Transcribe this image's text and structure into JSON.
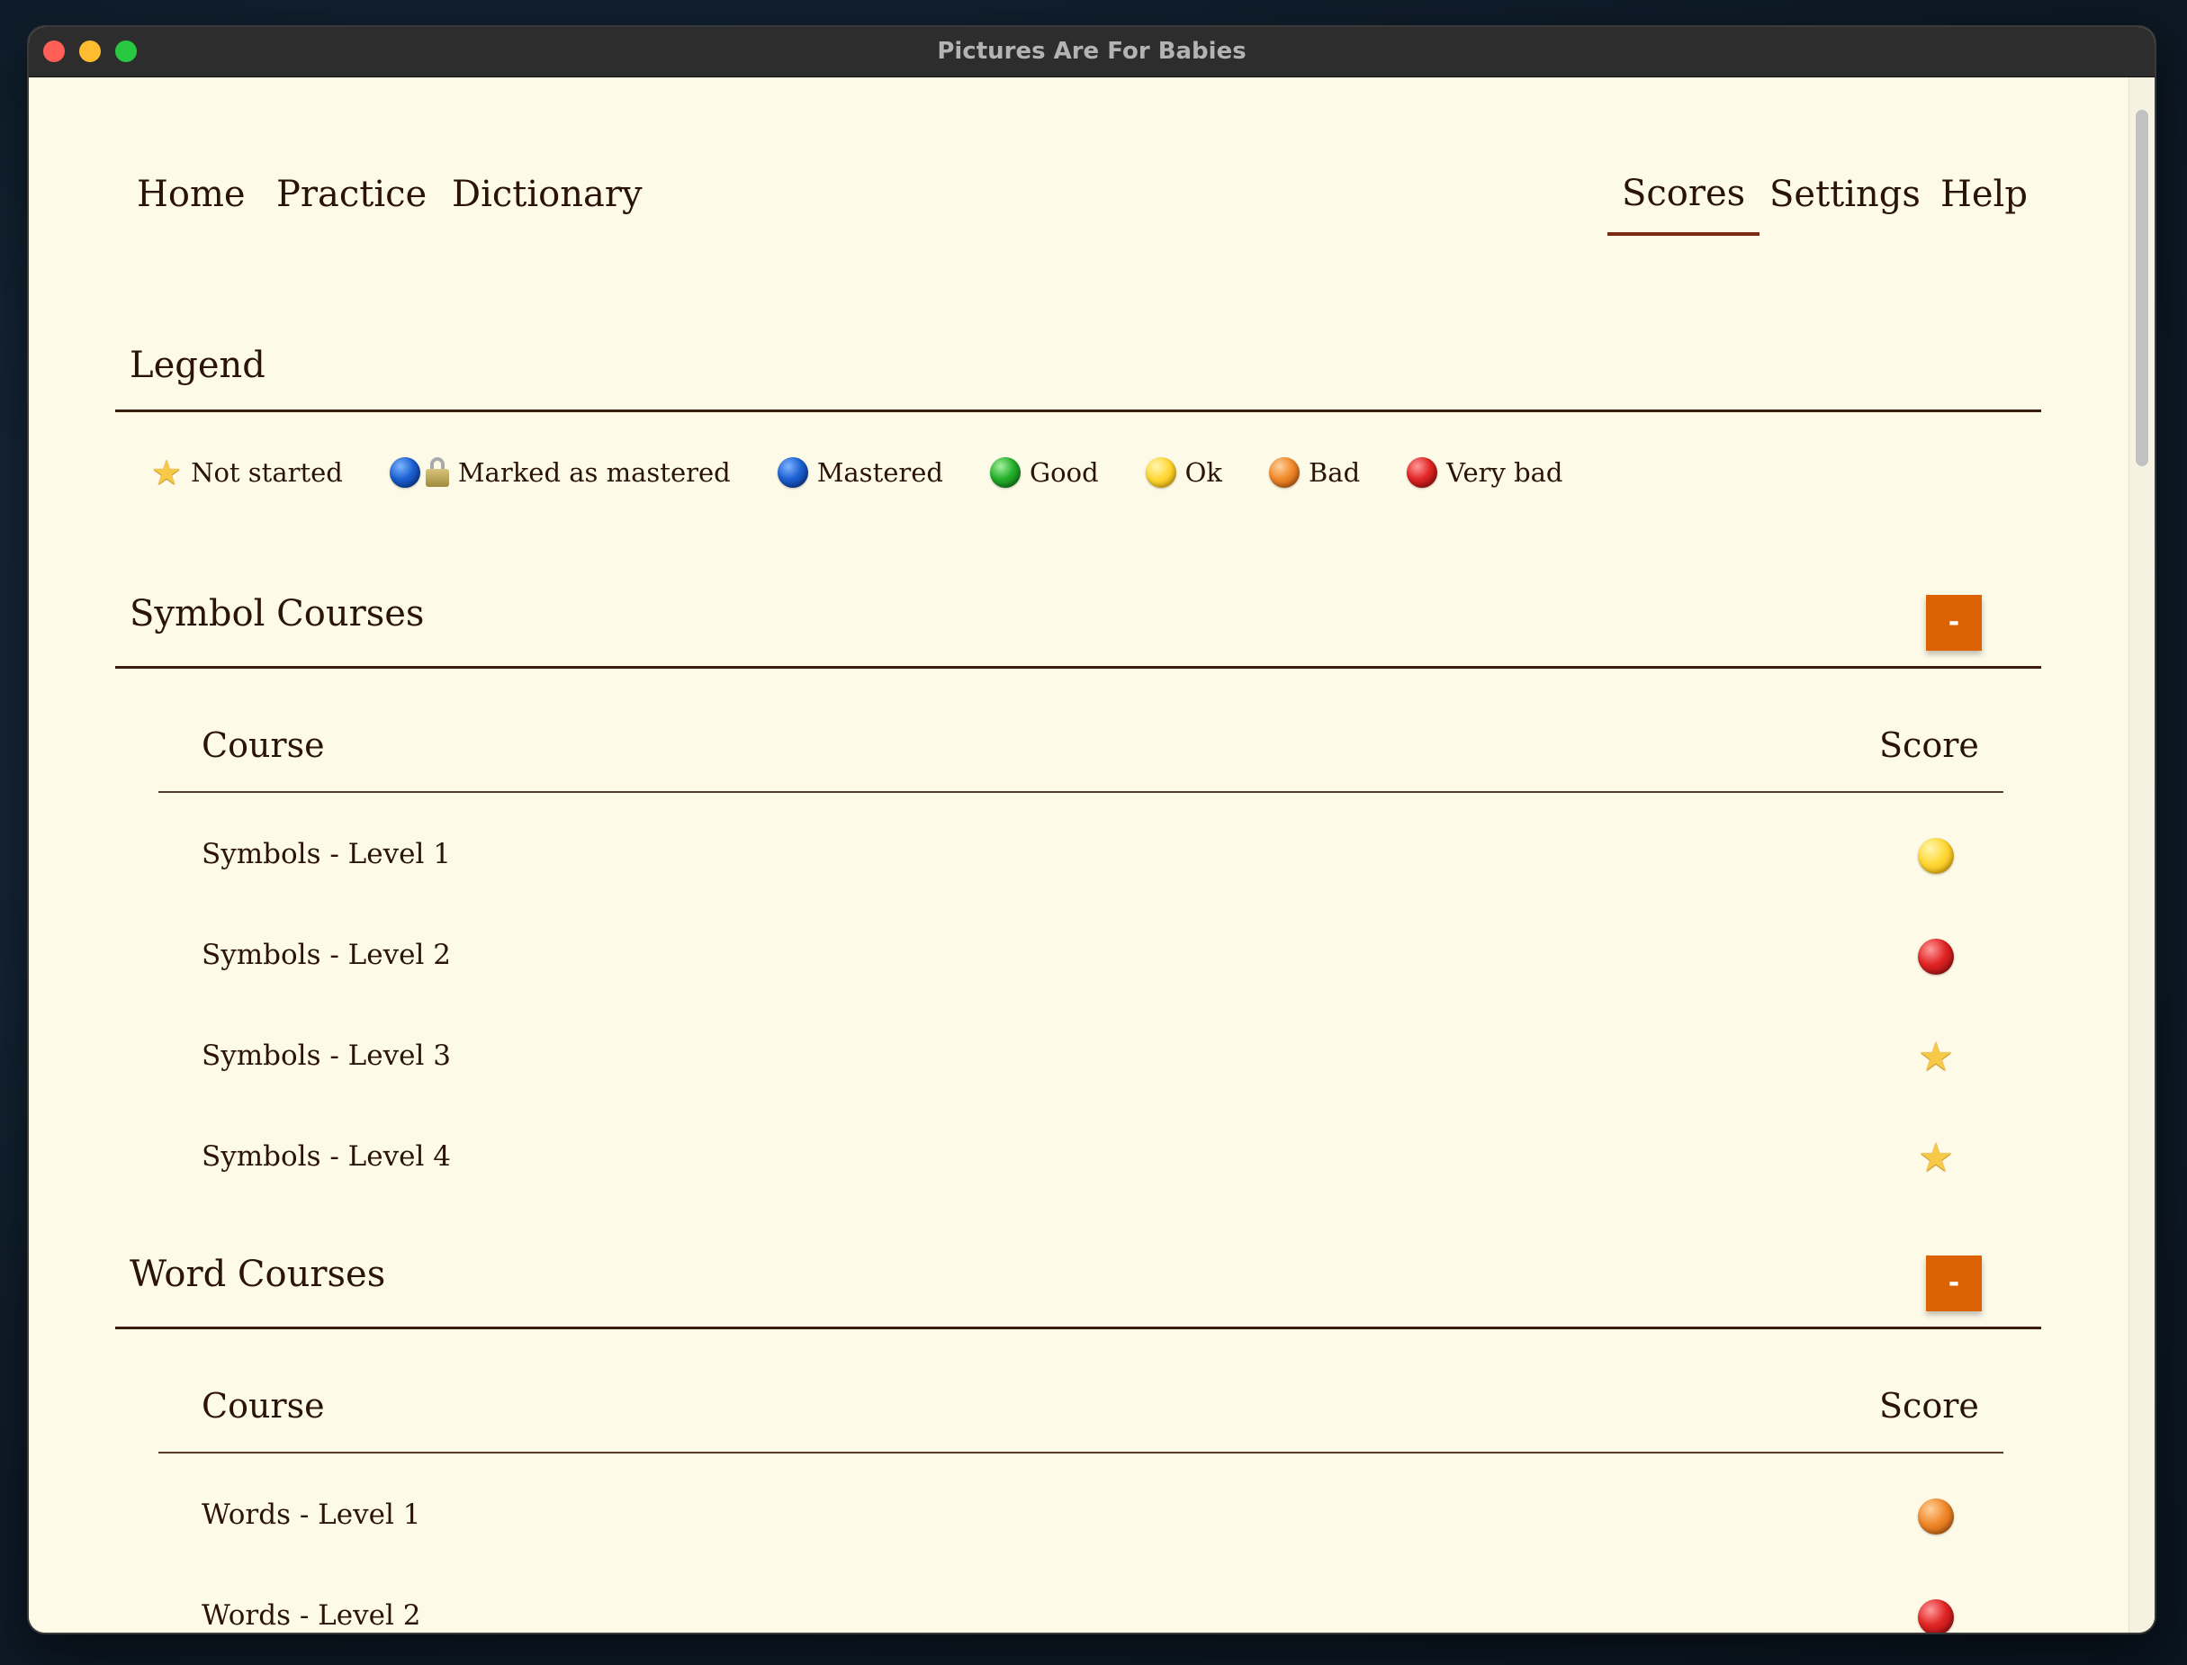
{
  "window": {
    "title": "Pictures Are For Babies"
  },
  "nav": {
    "left": [
      "Home",
      "Practice",
      "Dictionary"
    ],
    "right": [
      "Scores",
      "Settings",
      "Help"
    ],
    "active": "Scores"
  },
  "legend": {
    "title": "Legend",
    "items": [
      {
        "icon": "star-icon",
        "label": "Not started"
      },
      {
        "icon": "blue-orb-lock-icon",
        "label": "Marked as mastered"
      },
      {
        "icon": "blue-orb-icon",
        "label": "Mastered"
      },
      {
        "icon": "green-orb-icon",
        "label": "Good"
      },
      {
        "icon": "yellow-orb-icon",
        "label": "Ok"
      },
      {
        "icon": "orange-orb-icon",
        "label": "Bad"
      },
      {
        "icon": "red-orb-icon",
        "label": "Very bad"
      }
    ]
  },
  "symbol_courses": {
    "title": "Symbol Courses",
    "toggle_label": "-",
    "col_course": "Course",
    "col_score": "Score",
    "rows": [
      {
        "course": "Symbols - Level 1",
        "score": "Ok"
      },
      {
        "course": "Symbols - Level 2",
        "score": "Very bad"
      },
      {
        "course": "Symbols - Level 3",
        "score": "Not started"
      },
      {
        "course": "Symbols - Level 4",
        "score": "Not started"
      }
    ]
  },
  "word_courses": {
    "title": "Word Courses",
    "toggle_label": "-",
    "col_course": "Course",
    "col_score": "Score",
    "rows": [
      {
        "course": "Words - Level 1",
        "score": "Bad"
      },
      {
        "course": "Words - Level 2",
        "score": "Very bad"
      }
    ]
  },
  "colors": {
    "background": "#fefae8",
    "text": "#2a1408",
    "accent": "#dc6203",
    "nav_underline": "#7a2c12"
  }
}
